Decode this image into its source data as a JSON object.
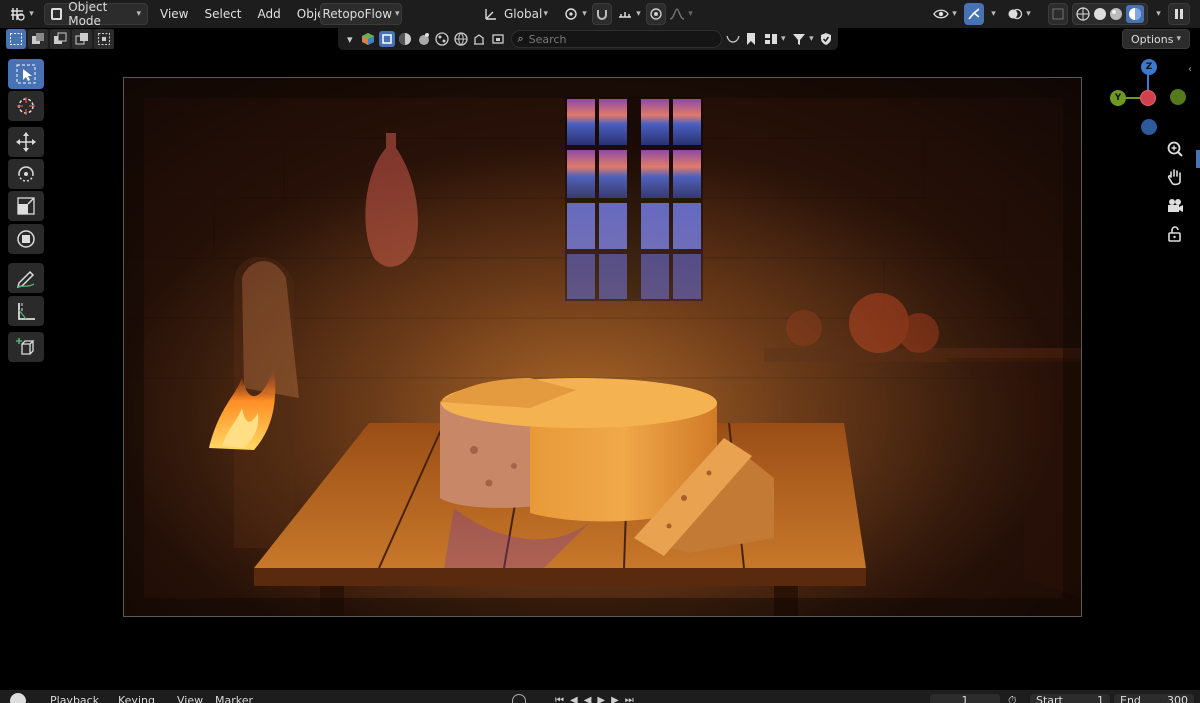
{
  "header": {
    "mode_selector": "Object Mode",
    "menus": [
      "View",
      "Select",
      "Add",
      "Object"
    ],
    "addon_menu": "RetopoFlow",
    "transform_orientation": "Global"
  },
  "toolbar2": {
    "search_placeholder": "Search",
    "options_label": "Options"
  },
  "gizmo": {
    "z": "Z",
    "y": "Y"
  },
  "timeline": {
    "playback": "Playback",
    "keying": "Keying",
    "view": "View",
    "marker": "Marker",
    "current_frame": "1",
    "start_label": "Start",
    "start_value": "1",
    "end_label": "End",
    "end_value": "300"
  },
  "colors": {
    "accent": "#4772b3",
    "header_bg": "#1d1d1d",
    "axis_x": "#d0404e",
    "axis_y": "#6e9a22",
    "axis_z": "#3c78d0"
  }
}
